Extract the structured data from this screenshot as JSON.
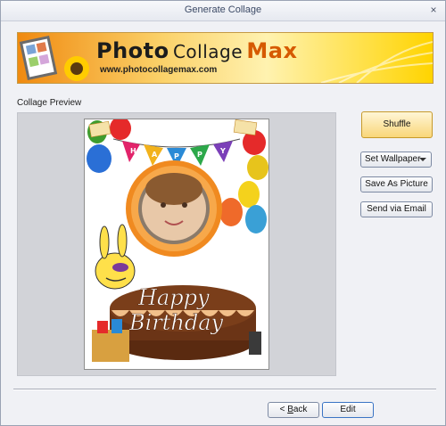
{
  "window": {
    "title": "Generate Collage",
    "close_glyph": "×"
  },
  "banner": {
    "title_word1": "Photo",
    "title_word2": "Collage",
    "title_word3": "Max",
    "url": "www.photocollagemax.com",
    "accent_color": "#d65a00",
    "background_colors": [
      "#f4a21a",
      "#fbd26a",
      "#ffd400"
    ]
  },
  "preview": {
    "section_label": "Collage Preview",
    "collage_text": {
      "line1": "Happy",
      "line2": "Birthday",
      "banner_letters": [
        "H",
        "A",
        "P",
        "P",
        "Y"
      ],
      "balloon_text": "Happy Birthday"
    }
  },
  "actions": {
    "shuffle_label": "Shuffle",
    "wallpaper_label": "Set Wallpaper",
    "save_picture_label": "Save As Picture",
    "email_label": "Send via Email"
  },
  "footer": {
    "back_label_prefix": "< ",
    "back_label_accel": "B",
    "back_label_rest": "ack",
    "edit_label": "Edit"
  }
}
